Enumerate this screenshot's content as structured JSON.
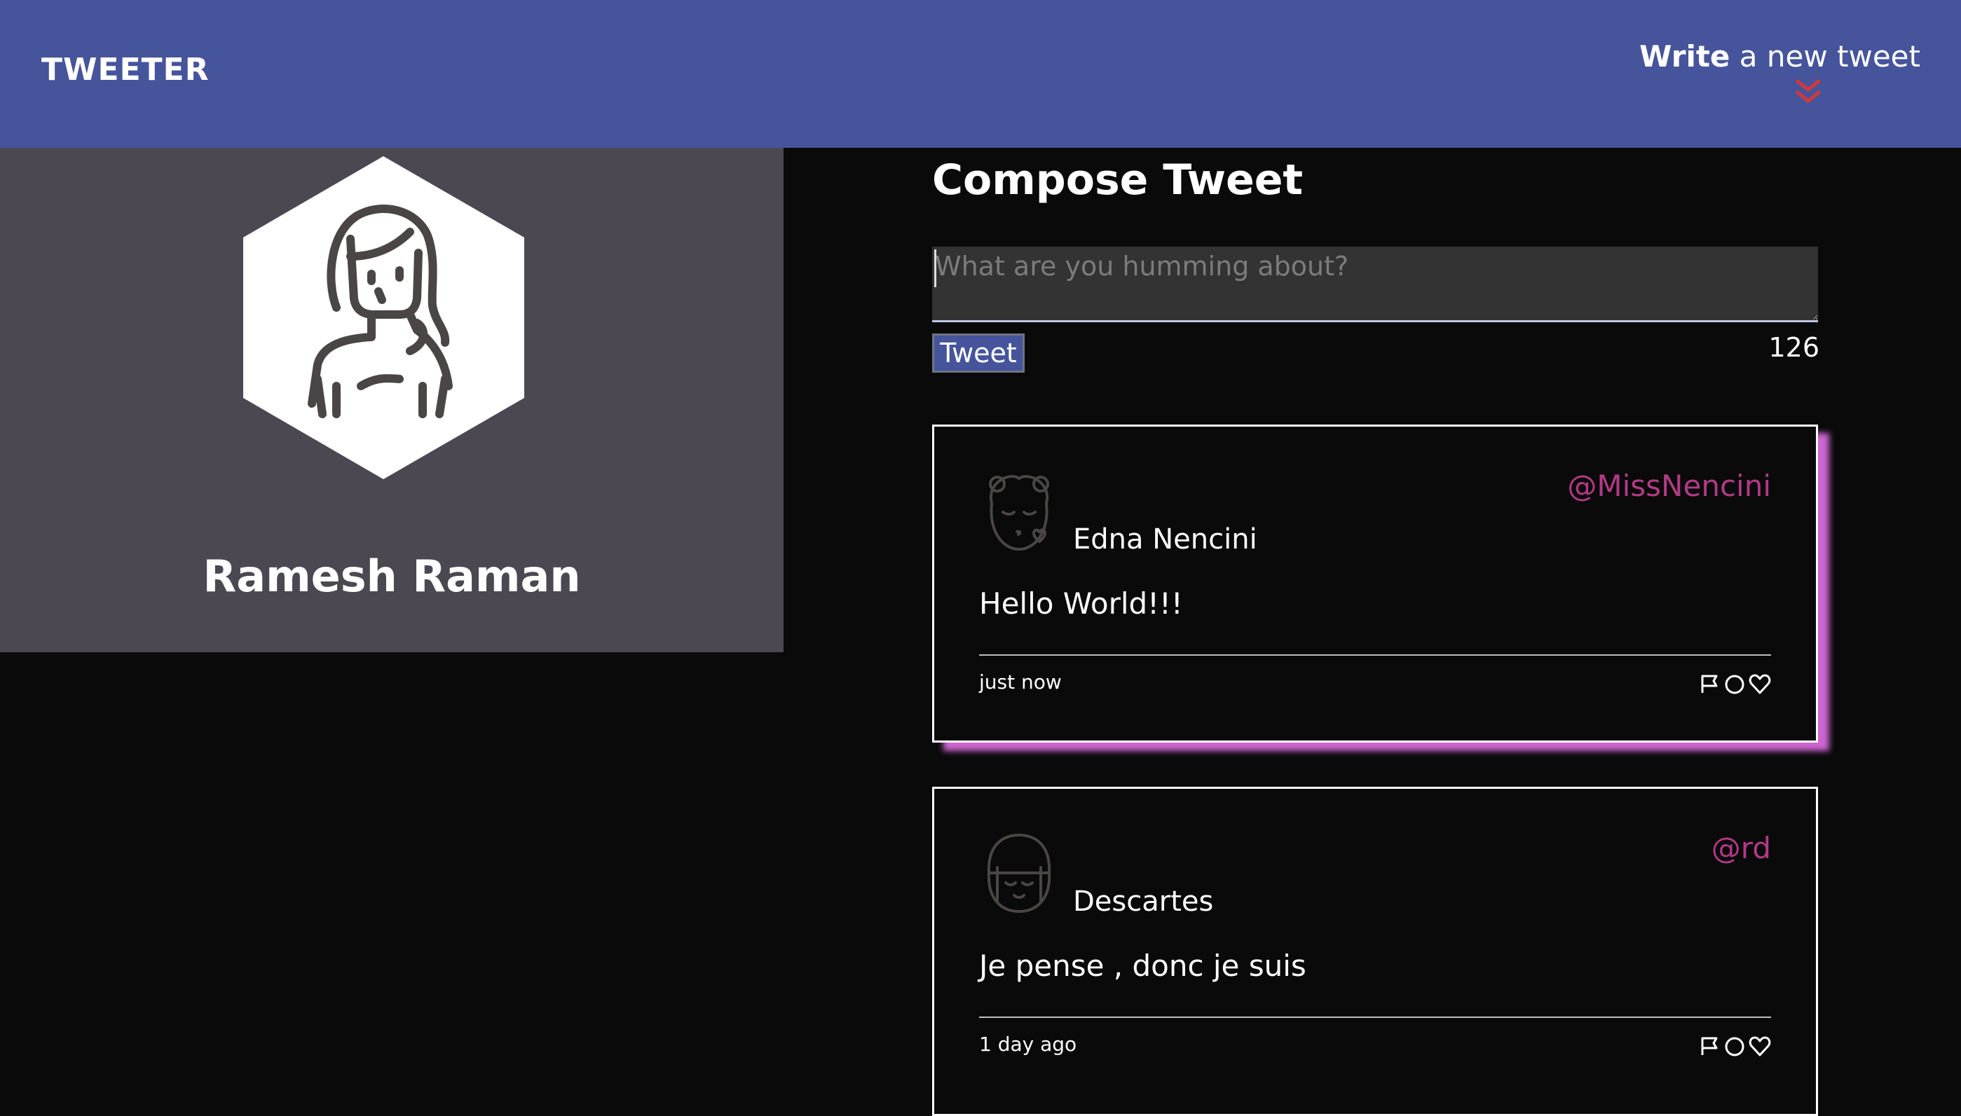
{
  "nav": {
    "brand": "TWEETER",
    "write_bold": "Write",
    "write_rest": " a new tweet",
    "toggle_icon": "double-chevron-down-icon"
  },
  "profile": {
    "name": "Ramesh Raman",
    "avatar_icon": "woman-avatar-icon"
  },
  "compose": {
    "title": "Compose Tweet",
    "placeholder": "What are you humming about?",
    "value": "",
    "button_label": "Tweet",
    "char_counter": "126"
  },
  "tweets": [
    {
      "name": "Edna Nencini",
      "handle": "@MissNencini",
      "text": "Hello World!!!",
      "time": "just now",
      "avatar_icon": "girl-kiss-avatar-icon"
    },
    {
      "name": "Descartes",
      "handle": "@rd",
      "text": "Je pense , donc je suis",
      "time": "1 day ago",
      "avatar_icon": "girl-smile-avatar-icon"
    }
  ],
  "colors": {
    "nav_bg": "#46549c",
    "profile_bg": "#4b4852",
    "page_bg": "#0a0a0a",
    "handle": "#b23a86",
    "tweet_glow": "#cc66d0",
    "chevron": "#d03a3a"
  }
}
